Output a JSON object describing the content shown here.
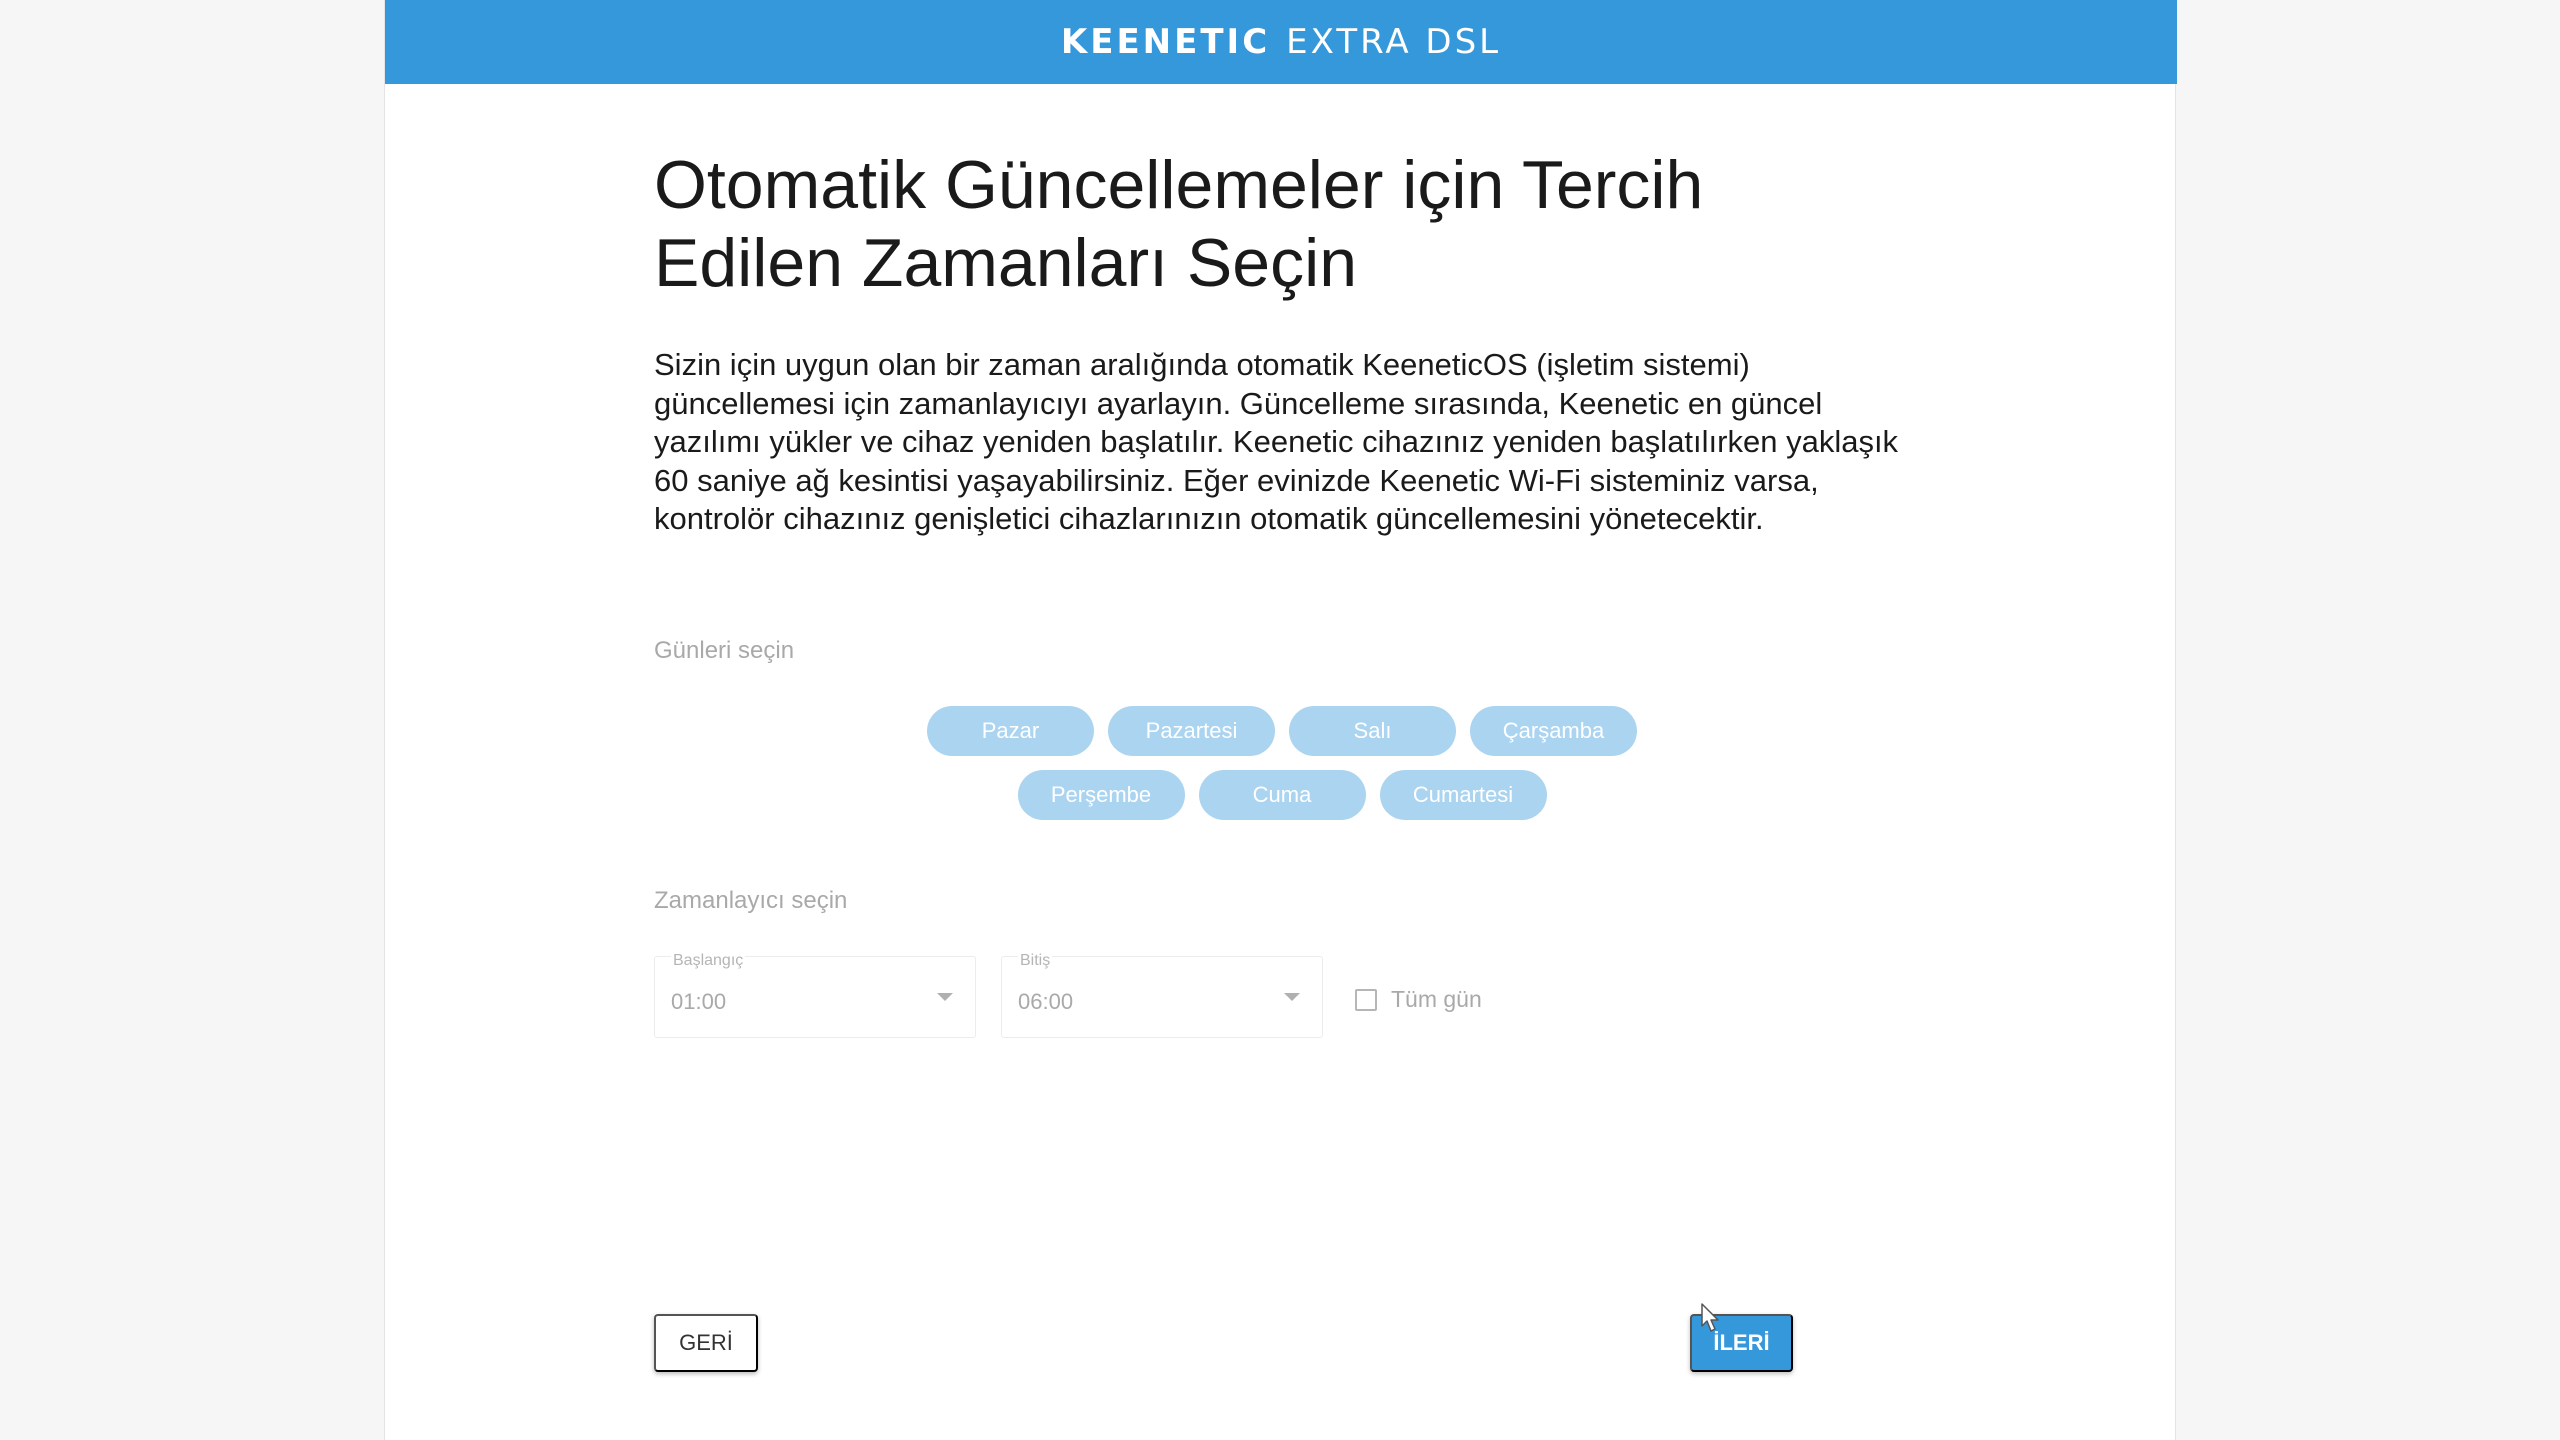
{
  "header": {
    "brand_main": "KEENETIC",
    "brand_model": "EXTRA DSL",
    "color": "#3598db"
  },
  "page": {
    "title": "Otomatik Güncellemeler için Tercih Edilen Zamanları Seçin",
    "description": "Sizin için uygun olan bir zaman aralığında otomatik KeeneticOS (işletim sistemi) güncellemesi için zamanlayıcıyı ayarlayın. Güncelleme sırasında, Keenetic en güncel yazılımı yükler ve cihaz yeniden başlatılır. Keenetic cihazınız yeniden başlatılırken yaklaşık 60 saniye ağ kesintisi yaşayabilirsiniz. Eğer evinizde Keenetic Wi-Fi sisteminiz varsa, kontrolör cihazınız genişletici cihazlarınızın otomatik güncellemesini yönetecektir."
  },
  "days": {
    "label": "Günleri seçin",
    "items": [
      "Pazar",
      "Pazartesi",
      "Salı",
      "Çarşamba",
      "Perşembe",
      "Cuma",
      "Cumartesi"
    ],
    "pill_color": "#abd4f0"
  },
  "timer": {
    "label": "Zamanlayıcı seçin",
    "start": {
      "caption": "Başlangıç",
      "value": "01:00"
    },
    "end": {
      "caption": "Bitiş",
      "value": "06:00"
    },
    "all_day": {
      "label": "Tüm gün",
      "checked": false
    }
  },
  "actions": {
    "back_label": "GERİ",
    "next_label": "İLERİ"
  }
}
